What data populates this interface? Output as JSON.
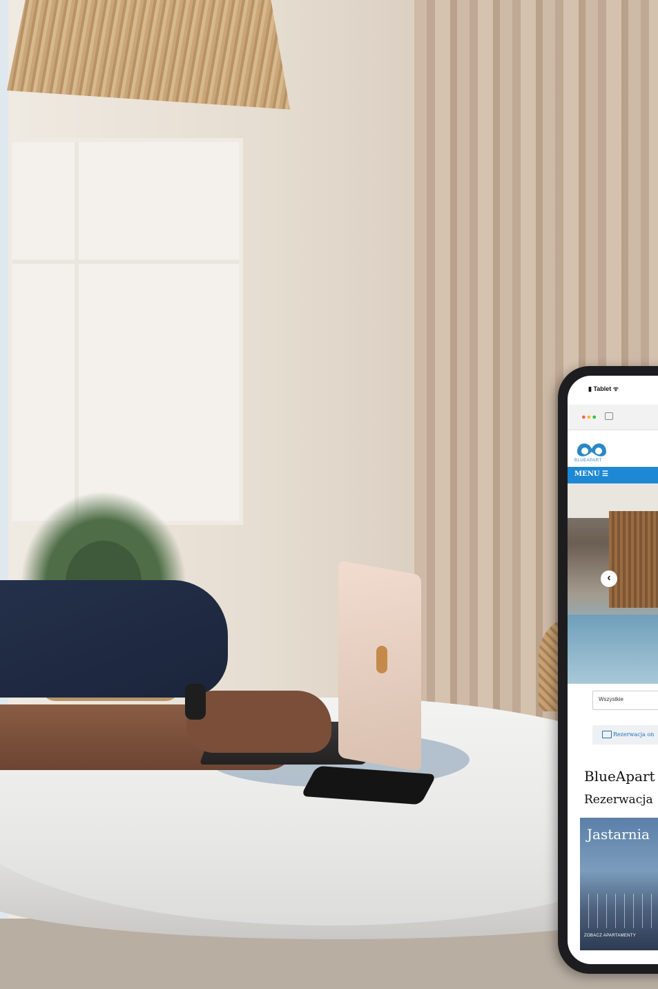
{
  "phone_site": {
    "status_bar": "Tablet",
    "logo_text": "BLUEAPART",
    "menu_label": "MENU ☰",
    "select_value": "Wszystkie",
    "booking_button_label": "Rezerwacja on",
    "heading_1": "BlueApart",
    "heading_2": "Rezerwacja",
    "card_title": "Jastarnia",
    "card_link": "ZOBACZ APARTAMENTY",
    "brand_color": "#1e88d4"
  }
}
